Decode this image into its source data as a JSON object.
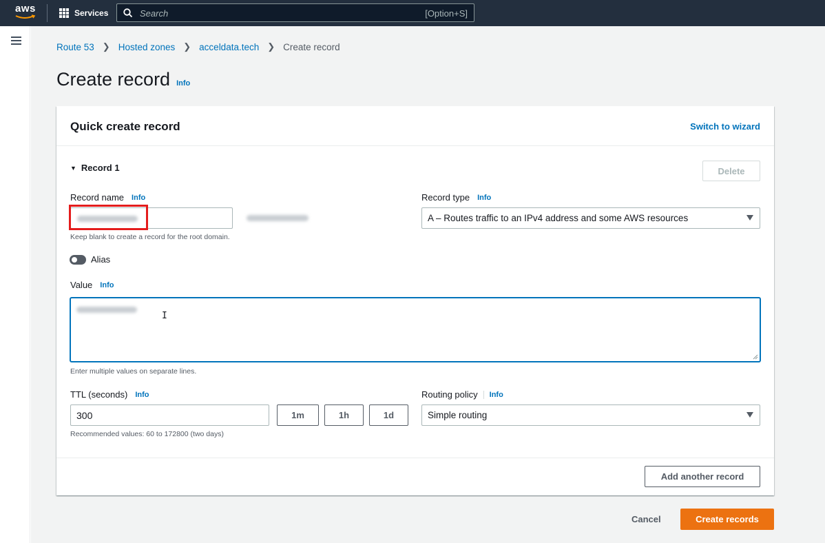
{
  "topnav": {
    "logo_text": "aws",
    "services_label": "Services",
    "search_placeholder": "Search",
    "search_shortcut": "[Option+S]"
  },
  "breadcrumb": {
    "items": [
      "Route 53",
      "Hosted zones",
      "acceldata.tech"
    ],
    "current": "Create record"
  },
  "page": {
    "title": "Create record",
    "info": "Info"
  },
  "panel": {
    "title": "Quick create record",
    "switch_label": "Switch to wizard",
    "record_label": "Record 1",
    "delete_label": "Delete",
    "record_name": {
      "label": "Record name",
      "info": "Info",
      "hint": "Keep blank to create a record for the root domain."
    },
    "record_type": {
      "label": "Record type",
      "info": "Info",
      "selected": "A – Routes traffic to an IPv4 address and some AWS resources"
    },
    "alias_label": "Alias",
    "value": {
      "label": "Value",
      "info": "Info",
      "hint": "Enter multiple values on separate lines."
    },
    "ttl": {
      "label": "TTL (seconds)",
      "info": "Info",
      "value": "300",
      "buttons": [
        "1m",
        "1h",
        "1d"
      ],
      "hint": "Recommended values: 60 to 172800 (two days)"
    },
    "routing": {
      "label": "Routing policy",
      "info": "Info",
      "selected": "Simple routing"
    },
    "add_another_label": "Add another record"
  },
  "footer": {
    "cancel_label": "Cancel",
    "create_label": "Create records"
  },
  "colors": {
    "nav_bg": "#232f3e",
    "link": "#0073bb",
    "primary": "#ec7211",
    "highlight": "#e41c1c"
  }
}
